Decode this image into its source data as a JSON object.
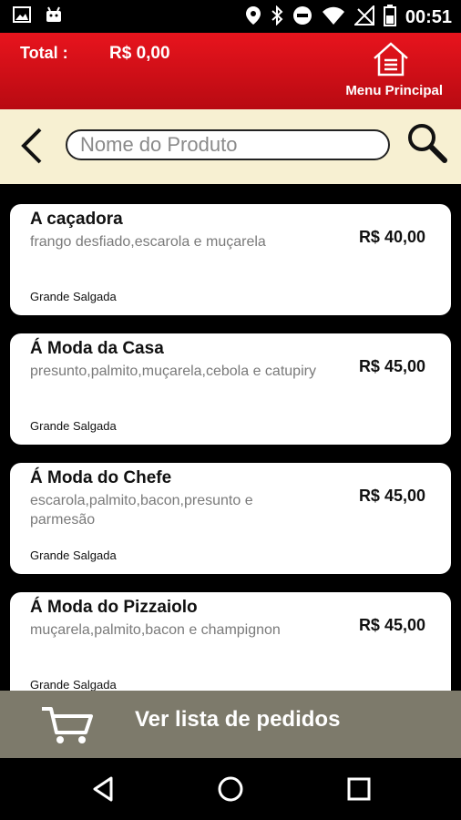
{
  "status_bar": {
    "time": "00:51",
    "icons": [
      "image-icon",
      "android-icon",
      "location-icon",
      "bluetooth-icon",
      "do-not-disturb-icon",
      "wifi-icon",
      "no-signal-icon",
      "battery-icon"
    ]
  },
  "header": {
    "total_label": "Total :",
    "total_value": "R$ 0,00",
    "menu_label": "Menu Principal"
  },
  "search": {
    "placeholder": "Nome do Produto"
  },
  "products": [
    {
      "name": "A caçadora",
      "description": "frango desfiado,escarola e muçarela",
      "price": "R$ 40,00",
      "category": "Grande Salgada"
    },
    {
      "name": "Á Moda da Casa",
      "description": "presunto,palmito,muçarela,cebola e catupiry",
      "price": "R$ 45,00",
      "category": "Grande Salgada"
    },
    {
      "name": "Á Moda do Chefe",
      "description": "escarola,palmito,bacon,presunto e parmesão",
      "price": "R$ 45,00",
      "category": "Grande Salgada"
    },
    {
      "name": "Á Moda do Pizzaiolo",
      "description": "muçarela,palmito,bacon e champignon",
      "price": "R$ 45,00",
      "category": "Grande Salgada"
    }
  ],
  "cart_bar": {
    "label": "Ver lista de pedidos"
  },
  "colors": {
    "header_red": "#d8101a",
    "search_bg": "#f7f0d2",
    "cart_bar_bg": "#7d7a6b"
  }
}
